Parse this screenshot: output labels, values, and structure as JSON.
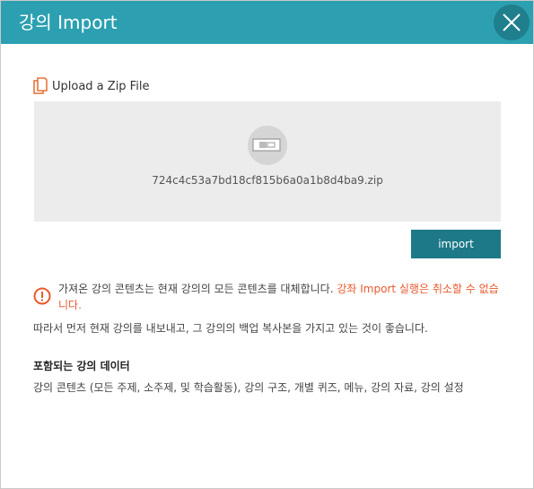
{
  "dialog": {
    "title": "강의 Import",
    "close_icon": "close-icon",
    "accent_color": "#2ca0b1"
  },
  "upload": {
    "label": "Upload a Zip File",
    "icon": "file-copy-icon",
    "filename": "724c4c53a7bd18cf815b6a0a1b8d4ba9.zip",
    "zip_icon": "zip-file-icon"
  },
  "import_button": {
    "label": "import"
  },
  "warning": {
    "icon": "alert-circle-icon",
    "text": "가져온 강의 콘텐츠는 현재 강의의 모든 콘텐츠를 대체합니다. ",
    "emphasis": "강좌 Import 실행은 취소할 수 없습니다.",
    "emphasis_color": "#e85a2e"
  },
  "advice": "따라서 먼저 현재 강의를 내보내고, 그 강의의 백업 복사본을 가지고 있는 것이 좋습니다.",
  "included": {
    "title": "포함되는 강의 데이터",
    "body": "강의 콘텐츠 (모든 주제, 소주제, 및 학습활동), 강의 구조, 개별 퀴즈, 메뉴, 강의 자료, 강의 설정"
  }
}
